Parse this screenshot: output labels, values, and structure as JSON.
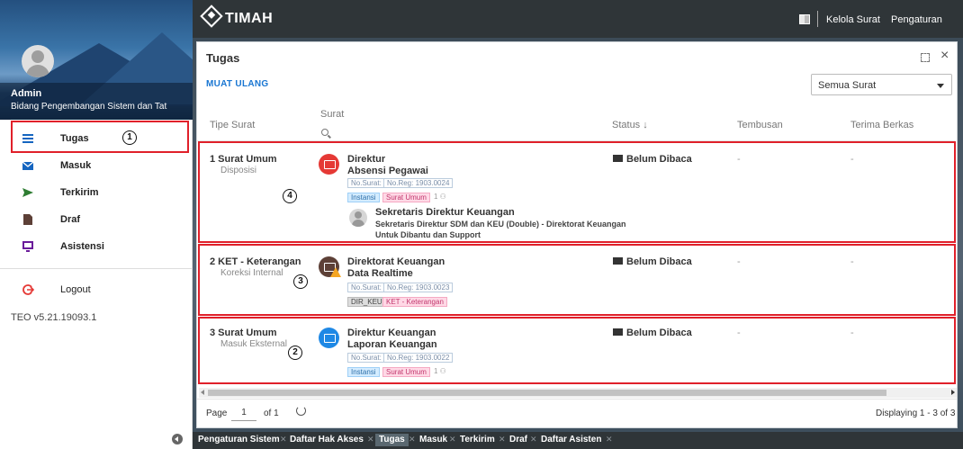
{
  "topbar": {
    "brand": "TIMAH",
    "links": [
      "Kelola Surat",
      "Pengaturan"
    ]
  },
  "sidebar": {
    "user_name": "Admin",
    "user_unit": "Bidang Pengembangan Sistem dan Tat",
    "items": [
      {
        "label": "Tugas",
        "icon": "list-icon",
        "color": "#1565c0"
      },
      {
        "label": "Masuk",
        "icon": "inbox-mail-icon",
        "color": "#1565c0"
      },
      {
        "label": "Terkirim",
        "icon": "send-icon",
        "color": "#2e7d32"
      },
      {
        "label": "Draf",
        "icon": "draft-file-icon",
        "color": "#5d4037"
      },
      {
        "label": "Asistensi",
        "icon": "monitor-icon",
        "color": "#6a1b9a"
      }
    ],
    "logout_label": "Logout",
    "version": "TEO v5.21.19093.1"
  },
  "panel": {
    "title": "Tugas",
    "reload_label": "MUAT ULANG",
    "filter_value": "Semua Surat",
    "columns": {
      "tipe": "Tipe Surat",
      "surat": "Surat",
      "status": "Status ↓",
      "tembusan": "Tembusan",
      "terima": "Terima Berkas"
    }
  },
  "rows": [
    {
      "num_type": "1  Surat Umum",
      "subtype": "Disposisi",
      "icon_color": "#e53935",
      "from": "Direktur",
      "subject": "Absensi Pegawai",
      "no_surat": "No.Surat: -",
      "no_reg": "No.Reg: 1903.0024",
      "tags": [
        "Instansi",
        "Surat Umum"
      ],
      "attach": "1 ⚇",
      "status": "Belum Dibaca",
      "tembusan": "-",
      "terima": "-",
      "cc_name": "Sekretaris Direktur Keuangan",
      "cc_detail": "Sekretaris Direktur SDM dan KEU (Double) - Direktorat Keuangan",
      "cc_note": "Untuk Dibantu dan Support",
      "callout": "4"
    },
    {
      "num_type": "2  KET - Keterangan",
      "subtype": "Koreksi Internal",
      "icon_color": "#5d4037",
      "from": "Direktorat Keuangan",
      "subject": "Data Realtime",
      "no_surat": "No.Surat: -",
      "no_reg": "No.Reg: 1903.0023",
      "tags": [
        "DIR_KEU",
        "KET - Keterangan"
      ],
      "status": "Belum Dibaca",
      "tembusan": "-",
      "terima": "-",
      "callout": "3"
    },
    {
      "num_type": "3  Surat Umum",
      "subtype": "Masuk Eksternal",
      "icon_color": "#1e88e5",
      "from": "Direktur Keuangan",
      "subject": "Laporan Keuangan",
      "no_surat": "No.Surat: -",
      "no_reg": "No.Reg: 1903.0022",
      "tags": [
        "Instansi",
        "Surat Umum"
      ],
      "attach": "1 ⚇",
      "status": "Belum Dibaca",
      "tembusan": "-",
      "terima": "-",
      "callout": "2"
    }
  ],
  "nav_callout": "1",
  "pager": {
    "page_label": "Page",
    "page_value": "1",
    "of_label": "of 1",
    "display": "Displaying 1 - 3 of 3"
  },
  "tabs": [
    "Pengaturan Sistem",
    "Daftar Hak Akses",
    "Tugas",
    "Masuk",
    "Terkirim",
    "Draf",
    "Daftar Asisten"
  ],
  "active_tab": "Tugas",
  "highlight_color": "#e0202a"
}
